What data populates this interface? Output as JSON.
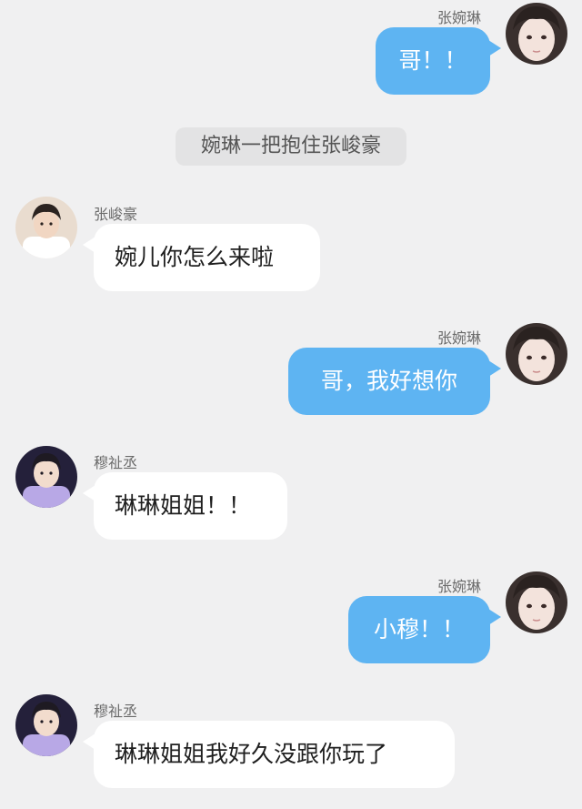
{
  "system_notice": "婉琳一把抱住张峻豪",
  "messages": [
    {
      "side": "right",
      "sender": "张婉琳",
      "text": "哥！！",
      "avatar": "girl-avatar"
    },
    {
      "side": "left",
      "sender": "张峻豪",
      "text": "婉儿你怎么来啦",
      "avatar": "boy-avatar-white-shirt"
    },
    {
      "side": "right",
      "sender": "张婉琳",
      "text": "哥，我好想你",
      "avatar": "girl-avatar"
    },
    {
      "side": "left",
      "sender": "穆祉丞",
      "text": "琳琳姐姐！！",
      "avatar": "boy-avatar-purple-shirt"
    },
    {
      "side": "right",
      "sender": "张婉琳",
      "text": "小穆！！",
      "avatar": "girl-avatar"
    },
    {
      "side": "left",
      "sender": "穆祉丞",
      "text": "琳琳姐姐我好久没跟你玩了",
      "avatar": "boy-avatar-purple-shirt"
    }
  ],
  "colors": {
    "background": "#f0f0f1",
    "right_bubble": "#5eb4f2",
    "left_bubble": "#ffffff",
    "system_pill": "#e3e3e4"
  }
}
